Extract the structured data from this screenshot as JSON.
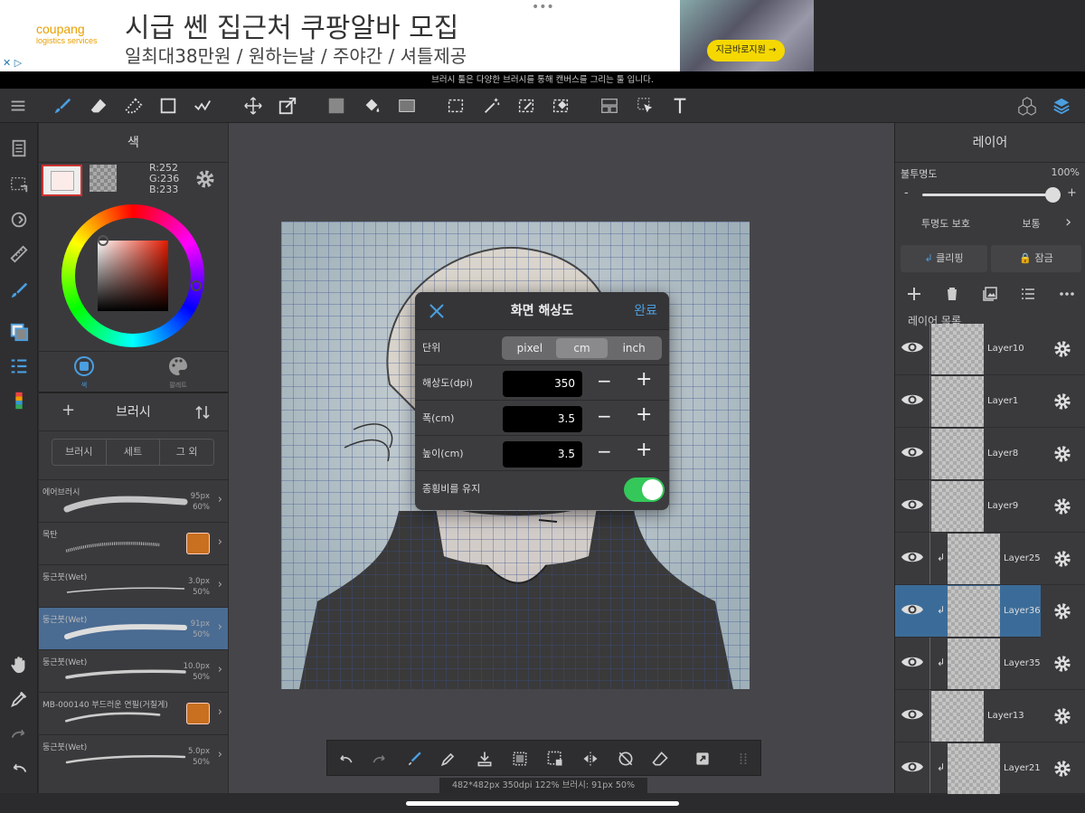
{
  "ad": {
    "logo": "coupang",
    "logo_sub": "logistics services",
    "title": "시급 쎈 집근처 쿠팡알바 모집",
    "subtitle": "일최대38만원 / 원하는날 / 주야간 / 셔틀제공",
    "cta": "지금바로지원 →",
    "dots": "•••",
    "adchoices": "✕ ▷"
  },
  "tip": "브러시 툴은 다양한 브러시를 통해 캔버스를 그리는 툴 입니다.",
  "color_panel": {
    "title": "색",
    "rgb_r": "R:252",
    "rgb_g": "G:236",
    "rgb_b": "B:233",
    "tab_color": "색",
    "tab_palette": "팔레트"
  },
  "brush_panel": {
    "title": "브러시",
    "add": "+",
    "tabs": [
      "브러시",
      "세트",
      "그 외"
    ],
    "items": [
      {
        "name": "에어브러시",
        "size": "95px",
        "opacity": "60%"
      },
      {
        "name": "목탄",
        "size": "",
        "opacity": ""
      },
      {
        "name": "둥근붓(Wet)",
        "size": "3.0px",
        "opacity": "50%"
      },
      {
        "name": "둥근붓(Wet)",
        "size": "91px",
        "opacity": "50%"
      },
      {
        "name": "둥근붓(Wet)",
        "size": "10.0px",
        "opacity": "50%"
      },
      {
        "name": "MB-000140 부드러운 연필(거칠게)",
        "size": "",
        "opacity": ""
      },
      {
        "name": "둥근붓(Wet)",
        "size": "5.0px",
        "opacity": "50%"
      }
    ]
  },
  "dialog": {
    "title": "화면 해상도",
    "done": "완료",
    "unit_label": "단위",
    "units": [
      "pixel",
      "cm",
      "inch"
    ],
    "unit_selected": "cm",
    "dpi_label": "해상도(dpi)",
    "dpi_value": "350",
    "width_label": "폭(cm)",
    "width_value": "3.5",
    "height_label": "높이(cm)",
    "height_value": "3.5",
    "keep_ratio_label": "종횡비를 유지",
    "keep_ratio": true,
    "minus": "−",
    "plus": "+"
  },
  "status": "482*482px 350dpi 122% 브러시: 91px 50%",
  "layer_panel": {
    "title": "레이어",
    "opacity_label": "불투명도",
    "opacity_value": "100%",
    "opacity_fraction": 1.0,
    "minus": "-",
    "plus": "+",
    "protect": "투명도 보호",
    "blend": "보통",
    "clipping": "클리핑",
    "lock": "잠금",
    "list_label": "레이어 목록",
    "layers": [
      {
        "name": "Layer10",
        "clipped": false,
        "selected": false
      },
      {
        "name": "Layer1",
        "clipped": false,
        "selected": false
      },
      {
        "name": "Layer8",
        "clipped": false,
        "selected": false
      },
      {
        "name": "Layer9",
        "clipped": false,
        "selected": false
      },
      {
        "name": "Layer25",
        "clipped": true,
        "selected": false
      },
      {
        "name": "Layer36",
        "clipped": true,
        "selected": true
      },
      {
        "name": "Layer35",
        "clipped": true,
        "selected": false
      },
      {
        "name": "Layer13",
        "clipped": false,
        "selected": false
      },
      {
        "name": "Layer21",
        "clipped": true,
        "selected": false
      }
    ]
  },
  "colors": {
    "accent": "#4a9fe0",
    "selected_row": "#3b6c99",
    "toggle_on": "#34c759",
    "current_color": "#fcece9"
  }
}
